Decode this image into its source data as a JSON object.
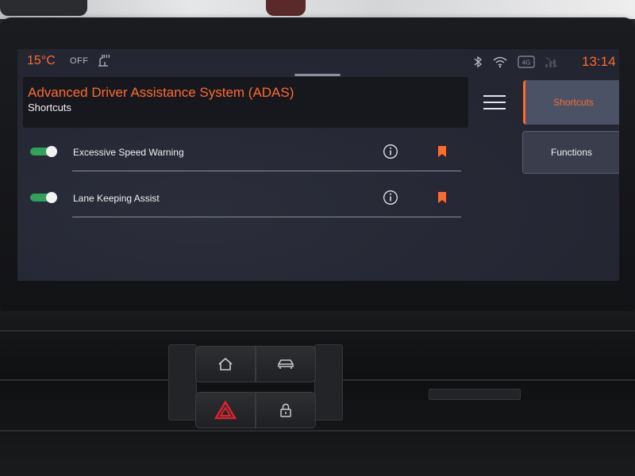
{
  "status_bar": {
    "temperature": "15°C",
    "seat_heating_state": "OFF",
    "clock": "13:14",
    "icons": [
      "seat-heating-icon",
      "bluetooth-icon",
      "wifi-icon",
      "network-4g-icon",
      "signal-icon"
    ]
  },
  "header": {
    "title": "Advanced Driver Assistance System (ADAS)",
    "subtitle": "Shortcuts"
  },
  "rows": [
    {
      "label": "Excessive Speed Warning",
      "enabled": true,
      "bookmarked": true
    },
    {
      "label": "Lane Keeping Assist",
      "enabled": true,
      "bookmarked": true
    }
  ],
  "side_nav": {
    "shortcuts_label": "Shortcuts",
    "functions_label": "Functions",
    "active": "Shortcuts"
  },
  "physical_buttons": [
    "home-icon",
    "car-icon",
    "hazard-icon",
    "lock-icon"
  ],
  "colors": {
    "accent": "#ff6a2e",
    "toggle_on": "#2fa35a",
    "screen_bg": "#262835",
    "header_bg": "#17181e",
    "hazard": "#e0232e"
  }
}
